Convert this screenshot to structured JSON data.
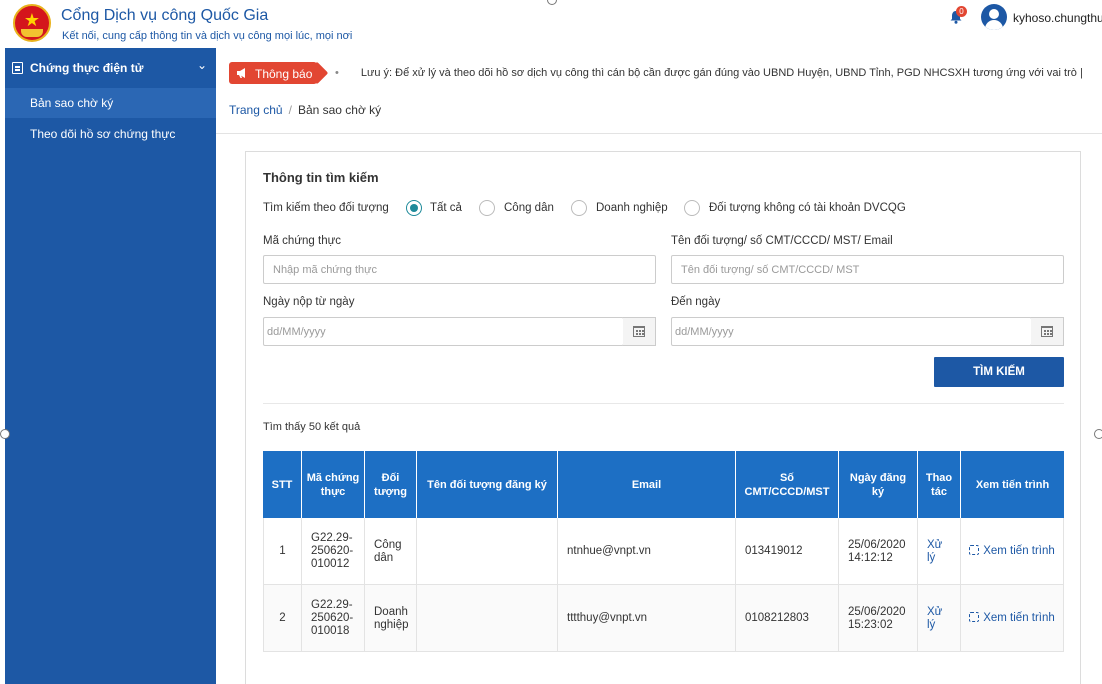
{
  "header": {
    "title": "Cổng Dịch vụ công Quốc Gia",
    "subtitle": "Kết nối, cung cấp thông tin và dịch vụ công mọi lúc, mọi nơi",
    "notification_count": "0",
    "username": "kyhoso.chungthu"
  },
  "sidebar": {
    "section_label": "Chứng thực điện tử",
    "items": [
      {
        "label": "Bản sao chờ ký",
        "active": true
      },
      {
        "label": "Theo dõi hồ sơ chứng thực",
        "active": false
      }
    ]
  },
  "notice": {
    "label": "Thông báo",
    "text": "Lưu ý: Để xử lý và theo dõi hồ sơ dịch vụ công thì cán bộ cần được gán đúng vào UBND Huyện, UBND Tỉnh, PGD NHCSXH tương ứng với vai trò",
    "separator": "|"
  },
  "breadcrumb": {
    "home": "Trang chủ",
    "separator": "/",
    "current": "Bản sao chờ ký"
  },
  "search": {
    "title": "Thông tin tìm kiếm",
    "filter_label": "Tìm kiếm theo đối tượng",
    "filter_options": [
      {
        "label": "Tất cả",
        "checked": true
      },
      {
        "label": "Công dân",
        "checked": false
      },
      {
        "label": "Doanh nghiệp",
        "checked": false
      },
      {
        "label": "Đối tượng không có tài khoản DVCQG",
        "checked": false
      }
    ],
    "code_label": "Mã chứng thực",
    "code_placeholder": "Nhập mã chứng thực",
    "subject_label": "Tên đối tượng/ số CMT/CCCD/ MST/ Email",
    "subject_placeholder": "Tên đối tượng/ số CMT/CCCD/ MST",
    "from_label": "Ngày nộp từ ngày",
    "from_placeholder": "dd/MM/yyyy",
    "to_label": "Đến ngày",
    "to_placeholder": "dd/MM/yyyy",
    "button_label": "TÌM KIẾM"
  },
  "results": {
    "count_text": "Tìm thấy 50 kết quả",
    "columns": [
      "STT",
      "Mã chứng thực",
      "Đối tượng",
      "Tên đối tượng đăng ký",
      "Email",
      "Số CMT/CCCD/MST",
      "Ngày đăng ký",
      "Thao tác",
      "Xem tiến trình"
    ],
    "rows": [
      {
        "stt": "1",
        "code": "G22.29-250620-010012",
        "type": "Công dân",
        "name": "",
        "email": "ntnhue@vnpt.vn",
        "id_number": "013419012",
        "date": "25/06/2020 14:12:12",
        "action": "Xử lý",
        "progress": "Xem tiến trình"
      },
      {
        "stt": "2",
        "code": "G22.29-250620-010018",
        "type": "Doanh nghiệp",
        "name": "",
        "email": "tttthuy@vnpt.vn",
        "id_number": "0108212803",
        "date": "25/06/2020 15:23:02",
        "action": "Xử lý",
        "progress": "Xem tiến trình"
      }
    ]
  },
  "colors": {
    "brand_blue": "#1d58a5",
    "table_header": "#1d6fc4",
    "notice_red": "#e24632",
    "radio_teal": "#1e8a9a"
  }
}
